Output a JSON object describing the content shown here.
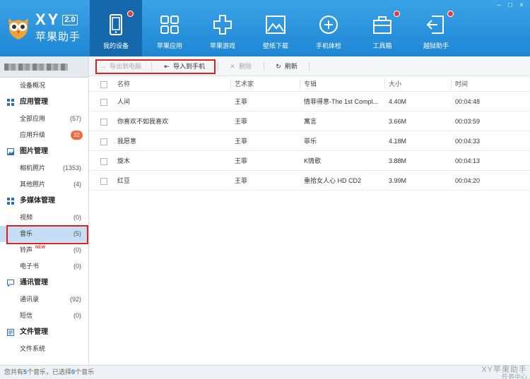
{
  "app": {
    "brand": "XY",
    "version": "2.0",
    "name_cn": "苹果助手"
  },
  "nav": [
    {
      "label": "我的设备",
      "icon": "phone-icon",
      "active": true,
      "dot": true
    },
    {
      "label": "苹果应用",
      "icon": "apps-grid-icon",
      "active": false,
      "dot": false
    },
    {
      "label": "苹果游戏",
      "icon": "gamepad-icon",
      "active": false,
      "dot": false
    },
    {
      "label": "壁纸下载",
      "icon": "wallpaper-icon",
      "active": false,
      "dot": false
    },
    {
      "label": "手机体检",
      "icon": "health-check-icon",
      "active": false,
      "dot": false
    },
    {
      "label": "工具箱",
      "icon": "toolbox-icon",
      "active": false,
      "dot": true
    },
    {
      "label": "越狱助手",
      "icon": "jailbreak-icon",
      "active": false,
      "dot": true
    }
  ],
  "window_controls": {
    "minimize": "–",
    "restore": "□",
    "close": "×"
  },
  "sidebar": {
    "overview": "设备概况",
    "groups": [
      {
        "title": "应用管理",
        "icon": "apps-icon",
        "items": [
          {
            "label": "全部应用",
            "count": "(57)"
          },
          {
            "label": "应用升级",
            "badge": "32"
          }
        ]
      },
      {
        "title": "图片管理",
        "icon": "image-icon",
        "items": [
          {
            "label": "相机照片",
            "count": "(1353)"
          },
          {
            "label": "其他照片",
            "count": "(4)"
          }
        ]
      },
      {
        "title": "多媒体管理",
        "icon": "media-icon",
        "items": [
          {
            "label": "视频",
            "count": "(0)"
          },
          {
            "label": "音乐",
            "count": "(5)",
            "selected": true
          },
          {
            "label": "铃声",
            "count": "(0)",
            "tag": "NEW"
          },
          {
            "label": "电子书",
            "count": "(0)"
          }
        ]
      },
      {
        "title": "通讯管理",
        "icon": "chat-icon",
        "items": [
          {
            "label": "通讯录",
            "count": "(92)"
          },
          {
            "label": "短信",
            "count": "(0)"
          }
        ]
      },
      {
        "title": "文件管理",
        "icon": "file-icon",
        "items": [
          {
            "label": "文件系统"
          }
        ]
      }
    ]
  },
  "toolbar": {
    "export_pc": "导出到电脑",
    "import_phone": "导入到手机",
    "delete": "删除",
    "refresh": "刷新"
  },
  "table": {
    "headers": [
      "名称",
      "艺术家",
      "专辑",
      "大小",
      "时间"
    ],
    "rows": [
      [
        "人间",
        "王菲",
        "情菲得意-The 1st Compl...",
        "4.40M",
        "00:04:48"
      ],
      [
        "你喜欢不如我喜欢",
        "王菲",
        "寓言",
        "3.66M",
        "00:03:59"
      ],
      [
        "我愿意",
        "王菲",
        "菲乐",
        "4.18M",
        "00:04:33"
      ],
      [
        "旋木",
        "王菲",
        "K情歌",
        "3.88M",
        "00:04:13"
      ],
      [
        "红豆",
        "王菲",
        "重拾女人心 HD CD2",
        "3.99M",
        "00:04:20"
      ]
    ]
  },
  "status": {
    "prefix": "您共有",
    "total": "5",
    "mid": "个音乐，已选择",
    "selected": "0",
    "suffix": "个音乐"
  },
  "watermark": {
    "line1": "XY苹果助手",
    "line2": "任务中心"
  },
  "colors": {
    "accent": "#1f86d4",
    "active_nav": "#1668ad",
    "highlight": "#e02020",
    "badge": "#f06a3c"
  }
}
